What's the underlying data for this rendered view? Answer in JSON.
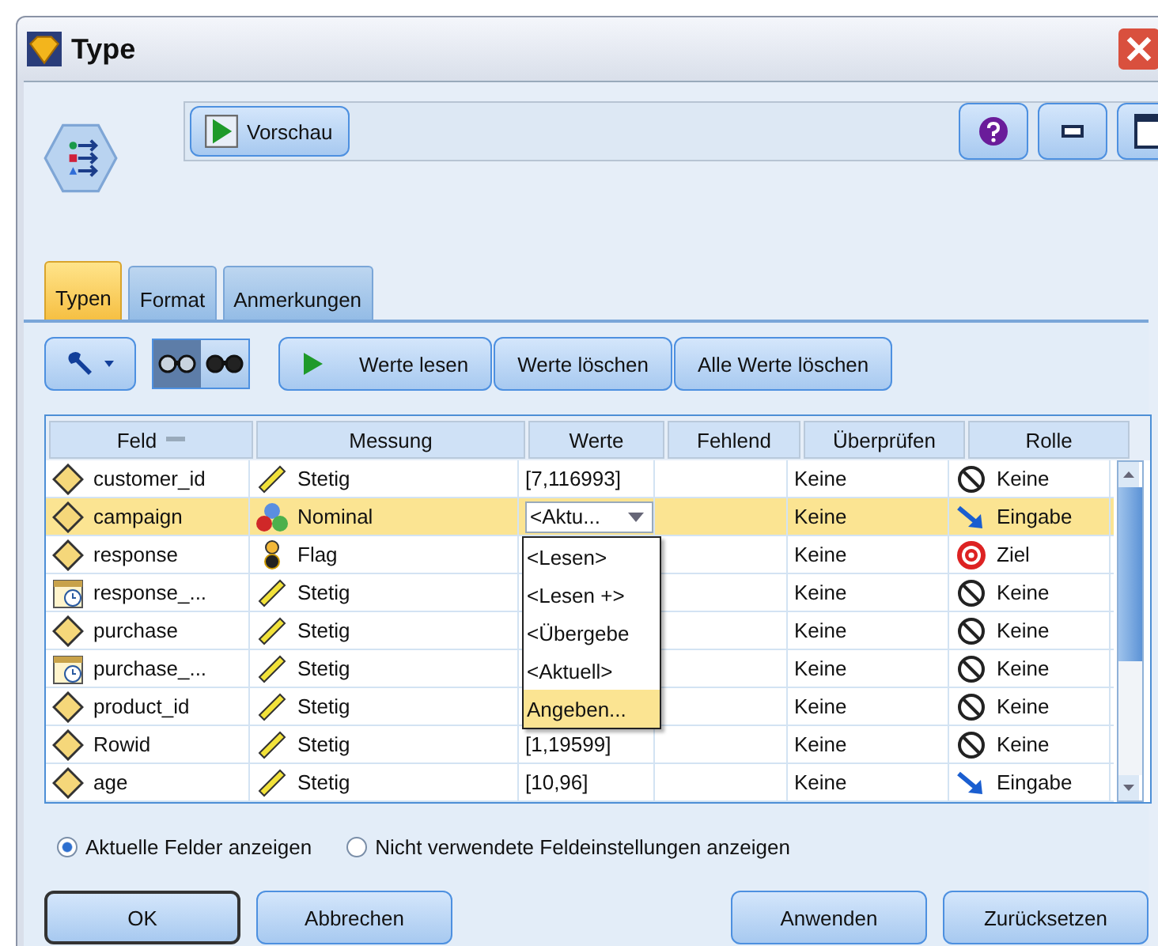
{
  "window": {
    "title": "Type"
  },
  "toolbar": {
    "preview_button": "Vorschau"
  },
  "tabs": [
    {
      "label": "Typen",
      "selected": true
    },
    {
      "label": "Format",
      "selected": false
    },
    {
      "label": "Anmerkungen",
      "selected": false
    }
  ],
  "tools": {
    "view_toggles": [
      {
        "selected": true
      },
      {
        "selected": false
      }
    ],
    "buttons": [
      {
        "label": "Werte lesen",
        "kind": "play"
      },
      {
        "label": "Werte löschen",
        "kind": "plain"
      },
      {
        "label": "Alle Werte löschen",
        "kind": "plain"
      }
    ]
  },
  "table": {
    "columns": [
      "Feld",
      "Messung",
      "Werte",
      "Fehlend",
      "Überprüfen",
      "Rolle"
    ],
    "rows": [
      {
        "field": {
          "text": "customer_id",
          "kind": "text"
        },
        "measurement": {
          "text": "Stetig",
          "kind": "continuous"
        },
        "values": {
          "text": "[7,116993]",
          "kind": "plain"
        },
        "check": "Keine",
        "role": {
          "text": "Keine",
          "kind": "none"
        },
        "selected": false
      },
      {
        "field": {
          "text": "campaign",
          "kind": "text"
        },
        "measurement": {
          "text": "Nominal",
          "kind": "nominal"
        },
        "values": {
          "text": "<Aktu...",
          "kind": "combo"
        },
        "check": "Keine",
        "role": {
          "text": "Eingabe",
          "kind": "input"
        },
        "selected": true
      },
      {
        "field": {
          "text": "response",
          "kind": "text"
        },
        "measurement": {
          "text": "Flag",
          "kind": "flag"
        },
        "check": "Keine",
        "role": {
          "text": "Ziel",
          "kind": "target"
        },
        "selected": false
      },
      {
        "field": {
          "text": "response_...",
          "kind": "date"
        },
        "measurement": {
          "text": "Stetig",
          "kind": "continuous"
        },
        "check": "Keine",
        "role": {
          "text": "Keine",
          "kind": "none"
        },
        "selected": false
      },
      {
        "field": {
          "text": "purchase",
          "kind": "text"
        },
        "measurement": {
          "text": "Stetig",
          "kind": "continuous"
        },
        "check": "Keine",
        "role": {
          "text": "Keine",
          "kind": "none"
        },
        "selected": false
      },
      {
        "field": {
          "text": "purchase_...",
          "kind": "date"
        },
        "measurement": {
          "text": "Stetig",
          "kind": "continuous"
        },
        "check": "Keine",
        "role": {
          "text": "Keine",
          "kind": "none"
        },
        "selected": false
      },
      {
        "field": {
          "text": "product_id",
          "kind": "text"
        },
        "measurement": {
          "text": "Stetig",
          "kind": "continuous"
        },
        "check": "Keine",
        "role": {
          "text": "Keine",
          "kind": "none"
        },
        "selected": false
      },
      {
        "field": {
          "text": "Rowid",
          "kind": "text"
        },
        "measurement": {
          "text": "Stetig",
          "kind": "continuous"
        },
        "values": {
          "text": "[1,19599]",
          "kind": "plain"
        },
        "check": "Keine",
        "role": {
          "text": "Keine",
          "kind": "none"
        },
        "selected": false
      },
      {
        "field": {
          "text": "age",
          "kind": "text"
        },
        "measurement": {
          "text": "Stetig",
          "kind": "continuous"
        },
        "values": {
          "text": "[10,96]",
          "kind": "plain"
        },
        "check": "Keine",
        "role": {
          "text": "Eingabe",
          "kind": "input"
        },
        "selected": false
      }
    ],
    "dropdown": [
      {
        "label": "<Lesen>",
        "selected": false
      },
      {
        "label": "<Lesen +>",
        "selected": false
      },
      {
        "label": "<Übergebe",
        "selected": false
      },
      {
        "label": "<Aktuell>",
        "selected": false
      },
      {
        "label": "Angeben...",
        "selected": true
      }
    ]
  },
  "radios": [
    {
      "label": "Aktuelle Felder anzeigen",
      "selected": true
    },
    {
      "label": "Nicht verwendete Feldeinstellungen anzeigen",
      "selected": false
    }
  ],
  "buttons_left": [
    {
      "label": "OK",
      "default": true
    },
    {
      "label": "Abbrechen",
      "default": false
    }
  ],
  "buttons_right": [
    "Anwenden",
    "Zurücksetzen"
  ]
}
